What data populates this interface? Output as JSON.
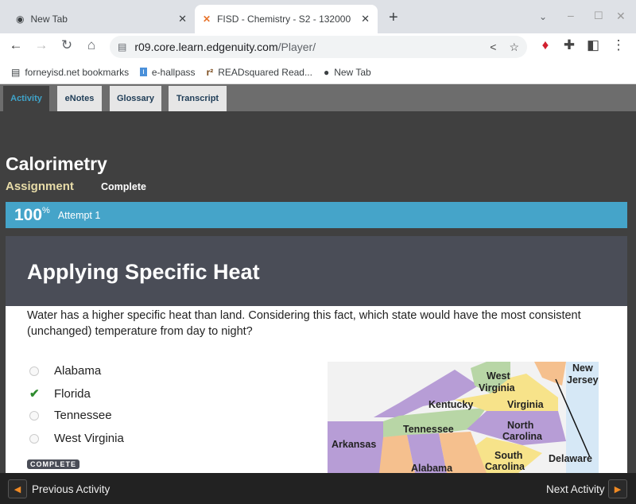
{
  "browser": {
    "tabs": [
      {
        "label": "New Tab",
        "icon": "chrome-icon"
      },
      {
        "label": "FISD - Chemistry - S2 - 132000 - ",
        "icon": "edgenuity-icon"
      }
    ],
    "url_host": "r09.core.learn.edgenuity.com",
    "url_path": "/Player/",
    "bookmarks": [
      {
        "label": "forneyisd.net bookmarks"
      },
      {
        "label": "e-hallpass"
      },
      {
        "label": "READsquared Read..."
      },
      {
        "label": "New Tab"
      }
    ]
  },
  "app_tabs": [
    "Activity",
    "eNotes",
    "Glossary",
    "Transcript"
  ],
  "lesson": {
    "title": "Calorimetry",
    "type": "Assignment",
    "status": "Complete"
  },
  "score": {
    "value": "100",
    "unit": "%",
    "attempt": "Attempt 1"
  },
  "activity": {
    "heading": "Applying Specific Heat",
    "question": "Water has a higher specific heat than land. Considering this fact, which state would have the most consistent (unchanged) temperature from day to night?",
    "options": [
      {
        "label": "Alabama",
        "selected": false
      },
      {
        "label": "Florida",
        "selected": true
      },
      {
        "label": "Tennessee",
        "selected": false
      },
      {
        "label": "West Virginia",
        "selected": false
      }
    ],
    "badge": "COMPLETE",
    "map_labels": [
      "West Virginia",
      "New Jersey",
      "Kentucky",
      "Virginia",
      "Tennessee",
      "North Carolina",
      "Arkansas",
      "South Carolina",
      "Delaware",
      "Alabama"
    ]
  },
  "footer": {
    "prev": "Previous Activity",
    "next": "Next Activity"
  },
  "colors": {
    "accent": "#45a4c9",
    "check": "#2e8b2e",
    "nav_arrow": "#f08a24"
  }
}
